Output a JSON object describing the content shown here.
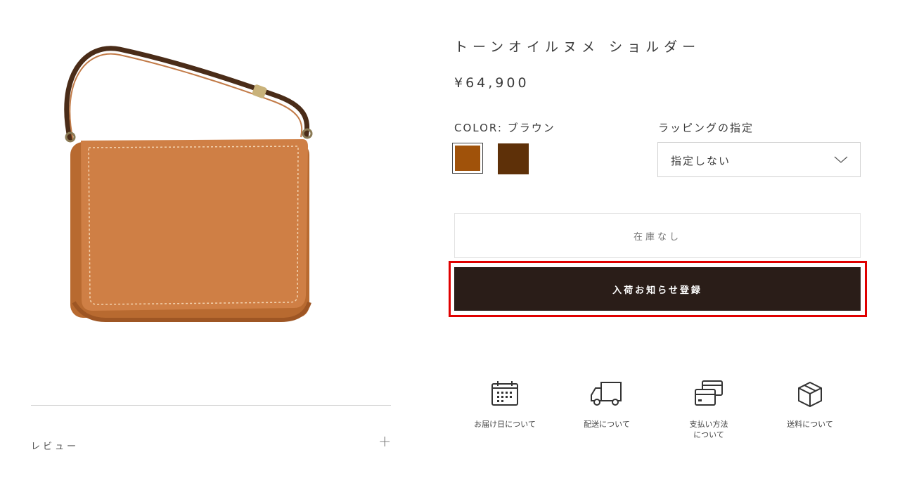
{
  "product": {
    "title": "トーンオイルヌメ ショルダー",
    "price": "¥64,900",
    "image_alt": "brown leather shoulder bag"
  },
  "color": {
    "label": "COLOR: ブラウン",
    "swatches": [
      {
        "name": "ブラウン",
        "hex": "#a0520a",
        "selected": true
      },
      {
        "name": "dark-brown",
        "hex": "#5e3008",
        "selected": false
      }
    ]
  },
  "wrapping": {
    "label": "ラッピングの指定",
    "selected": "指定しない"
  },
  "stock": {
    "status": "在庫なし"
  },
  "notify_button": {
    "label": "入荷お知らせ登録"
  },
  "info_links": [
    {
      "label": "お届け日について",
      "icon": "calendar-icon"
    },
    {
      "label": "配送について",
      "icon": "truck-icon"
    },
    {
      "label": "支払い方法\nについて",
      "icon": "credit-card-icon"
    },
    {
      "label": "送料について",
      "icon": "package-icon"
    }
  ],
  "review": {
    "label": "レビュー",
    "toggle": "+"
  },
  "colors": {
    "highlight": "#e00000",
    "button_bg": "#2a1d18"
  }
}
